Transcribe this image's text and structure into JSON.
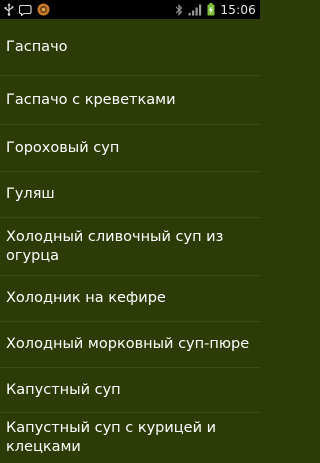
{
  "status_bar": {
    "time": "15:06",
    "icons": [
      "usb-icon",
      "speech-bubble-icon",
      "app-circle-icon",
      "bluetooth-icon",
      "signal-icon",
      "battery-charging-icon"
    ],
    "colors": {
      "background": "#000000",
      "battery_green": "#7ec03a",
      "notification_orange": "#c97a2a"
    }
  },
  "list": {
    "background": "#2d3b06",
    "items": [
      {
        "label": "Гаспачо"
      },
      {
        "label": "Гаспачо с креветками"
      },
      {
        "label": "Гороховый суп"
      },
      {
        "label": "Гуляш"
      },
      {
        "label": "Холодный сливочный суп из огурца"
      },
      {
        "label": "Холодник на кефире"
      },
      {
        "label": "Холодный морковный суп-пюре"
      },
      {
        "label": "Капустный суп"
      },
      {
        "label": "Капустный суп с курицей и клецками"
      }
    ]
  }
}
